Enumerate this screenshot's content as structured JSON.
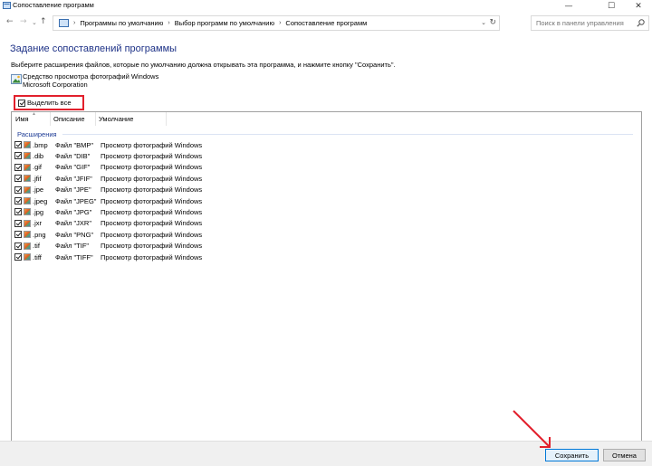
{
  "window": {
    "title": "Сопоставление программ",
    "controls": {
      "minimize": "—",
      "maximize": "☐",
      "close": "✕"
    }
  },
  "address_bar": {
    "breadcrumbs": [
      "Программы по умолчанию",
      "Выбор программ по умолчанию",
      "Сопоставление программ"
    ],
    "search_placeholder": "Поиск в панели управления"
  },
  "content": {
    "heading": "Задание сопоставлений программы",
    "description": "Выберите расширения файлов, которые по умолчанию должна открывать эта программа, и нажмите кнопку \"Сохранить\".",
    "program": {
      "name": "Средство просмотра фотографий Windows",
      "company": "Microsoft Corporation"
    },
    "select_all": {
      "label": "Выделить все",
      "checked": true,
      "highlight_color": "#e2202c"
    }
  },
  "list": {
    "columns": [
      "Имя",
      "Описание",
      "Умолчание"
    ],
    "group": "Расширения",
    "rows": [
      {
        "ext": ".bmp",
        "desc": "Файл \"BMP\"",
        "default": "Просмотр фотографий Windows",
        "checked": true
      },
      {
        "ext": ".dib",
        "desc": "Файл \"DIB\"",
        "default": "Просмотр фотографий Windows",
        "checked": true
      },
      {
        "ext": ".gif",
        "desc": "Файл \"GIF\"",
        "default": "Просмотр фотографий Windows",
        "checked": true
      },
      {
        "ext": ".jfif",
        "desc": "Файл \"JFIF\"",
        "default": "Просмотр фотографий Windows",
        "checked": true
      },
      {
        "ext": ".jpe",
        "desc": "Файл \"JPE\"",
        "default": "Просмотр фотографий Windows",
        "checked": true
      },
      {
        "ext": ".jpeg",
        "desc": "Файл \"JPEG\"",
        "default": "Просмотр фотографий Windows",
        "checked": true
      },
      {
        "ext": ".jpg",
        "desc": "Файл \"JPG\"",
        "default": "Просмотр фотографий Windows",
        "checked": true
      },
      {
        "ext": ".jxr",
        "desc": "Файл \"JXR\"",
        "default": "Просмотр фотографий Windows",
        "checked": true
      },
      {
        "ext": ".png",
        "desc": "Файл \"PNG\"",
        "default": "Просмотр фотографий Windows",
        "checked": true
      },
      {
        "ext": ".tif",
        "desc": "Файл \"TIF\"",
        "default": "Просмотр фотографий Windows",
        "checked": true
      },
      {
        "ext": ".tiff",
        "desc": "Файл \"TIFF\"",
        "default": "Просмотр фотографий Windows",
        "checked": true
      }
    ]
  },
  "footer": {
    "save_label": "Сохранить",
    "cancel_label": "Отмена"
  },
  "colors": {
    "heading": "#1e3287",
    "annotation": "#e2202c",
    "primary_button_border": "#0078d7"
  }
}
